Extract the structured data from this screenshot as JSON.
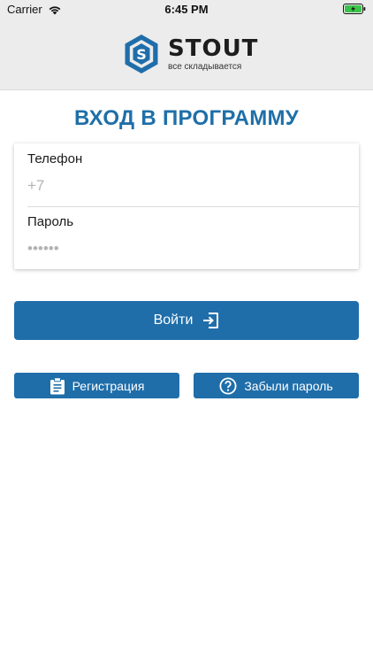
{
  "status_bar": {
    "carrier": "Carrier",
    "time": "6:45 PM",
    "icons": [
      "wifi-icon",
      "battery-charging-icon"
    ]
  },
  "brand": {
    "name": "STOUT",
    "tagline": "все складывается",
    "colors": {
      "primary": "#1f6eaa",
      "title": "#1f6fa8"
    }
  },
  "login": {
    "title": "ВХОД В ПРОГРАММУ",
    "phone": {
      "label": "Телефон",
      "placeholder": "+7",
      "value": ""
    },
    "password": {
      "label": "Пароль",
      "placeholder": "••••••",
      "value": ""
    },
    "submit_label": "Войти",
    "submit_icon": "login-arrow-icon"
  },
  "actions": {
    "register_label": "Регистрация",
    "register_icon": "clipboard-icon",
    "forgot_label": "Забыли пароль",
    "forgot_icon": "question-circle-icon"
  }
}
